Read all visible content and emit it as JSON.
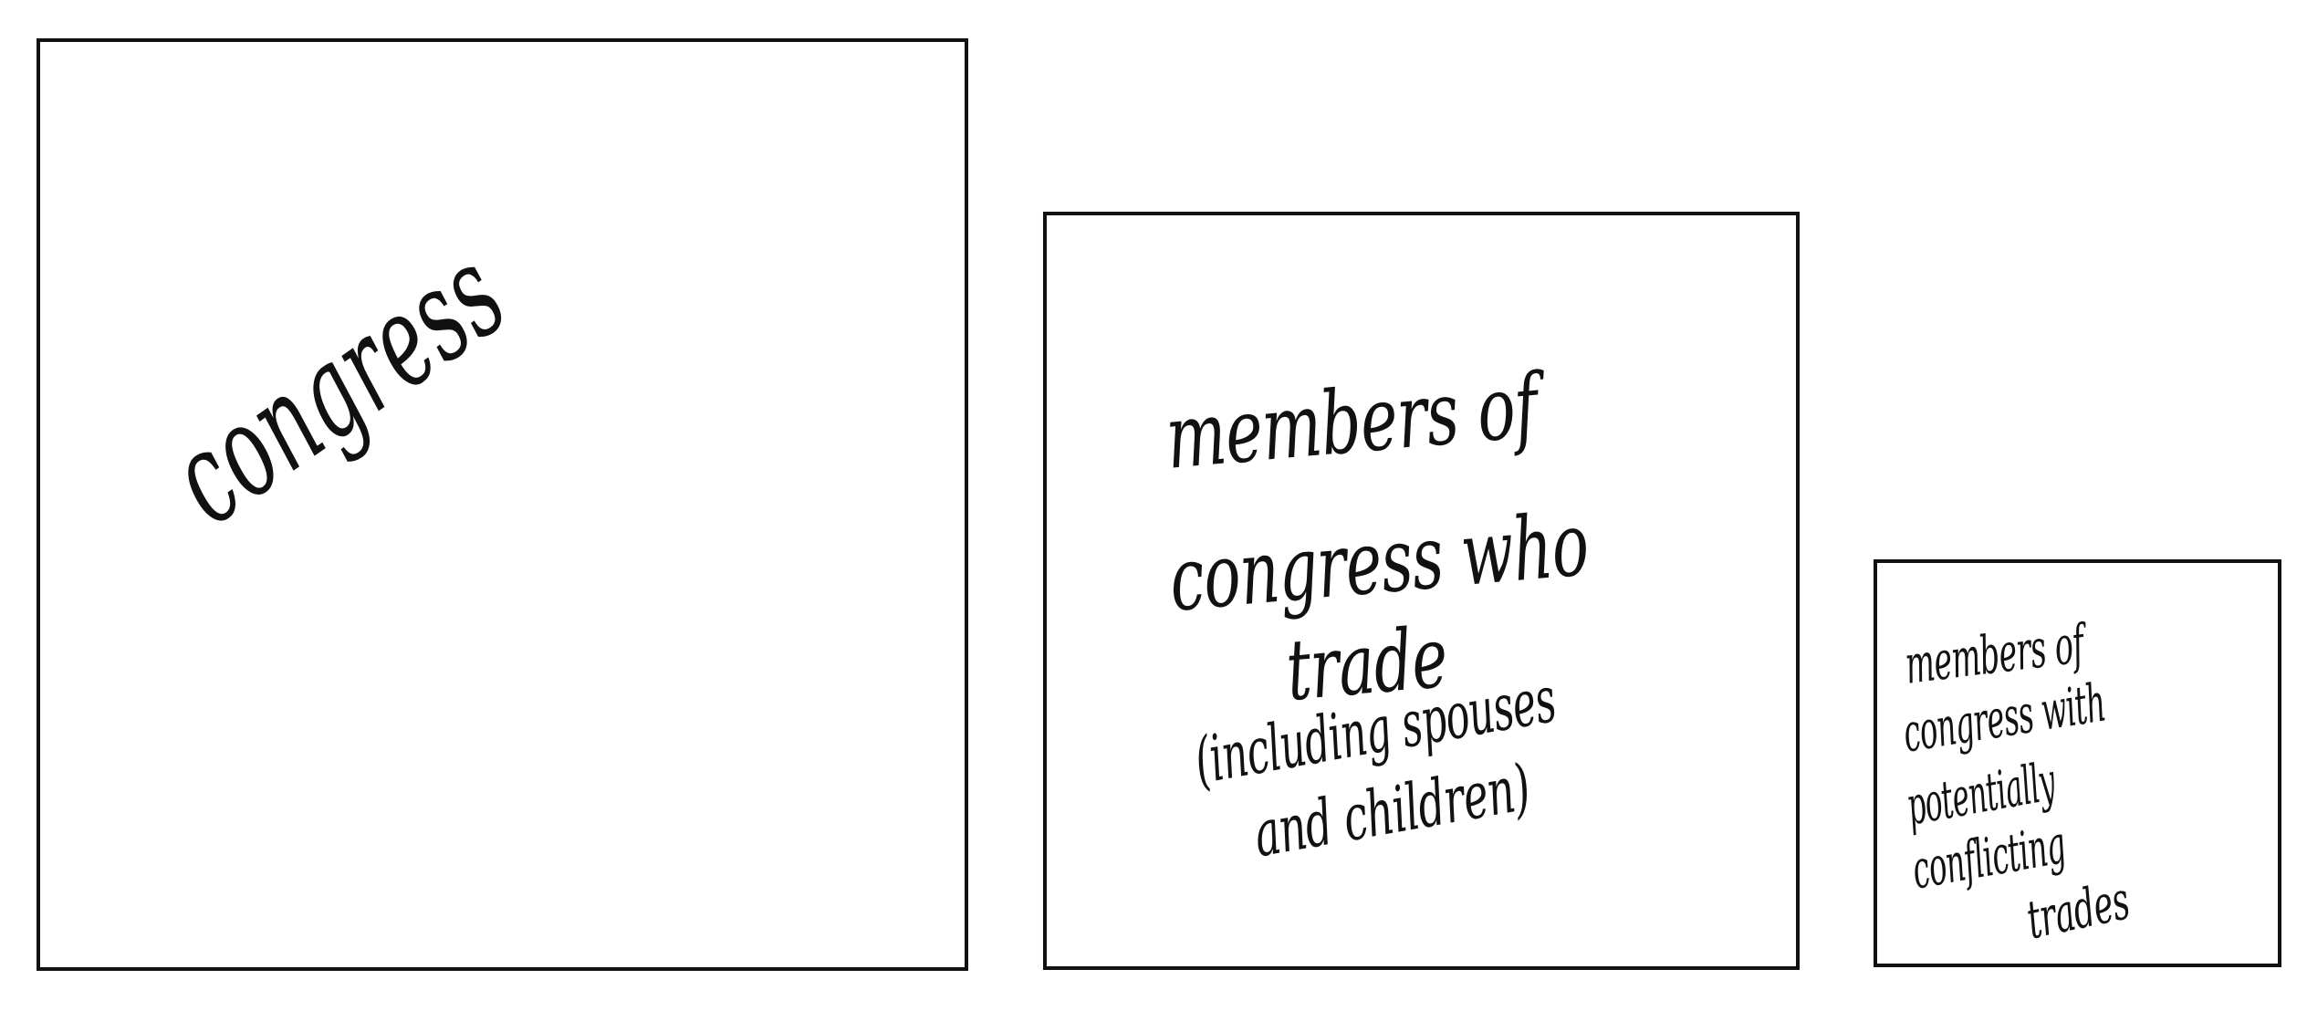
{
  "boxes": {
    "congress": {
      "label": "congress"
    },
    "trade": {
      "lines": [
        "members of",
        "congress who",
        "trade",
        "(including spouses",
        "and children)"
      ]
    },
    "conflict": {
      "lines": [
        "members of",
        "congress with",
        "potentially",
        "conflicting",
        "trades"
      ]
    }
  },
  "colors": {
    "ink": "#111111",
    "background": "#ffffff"
  }
}
